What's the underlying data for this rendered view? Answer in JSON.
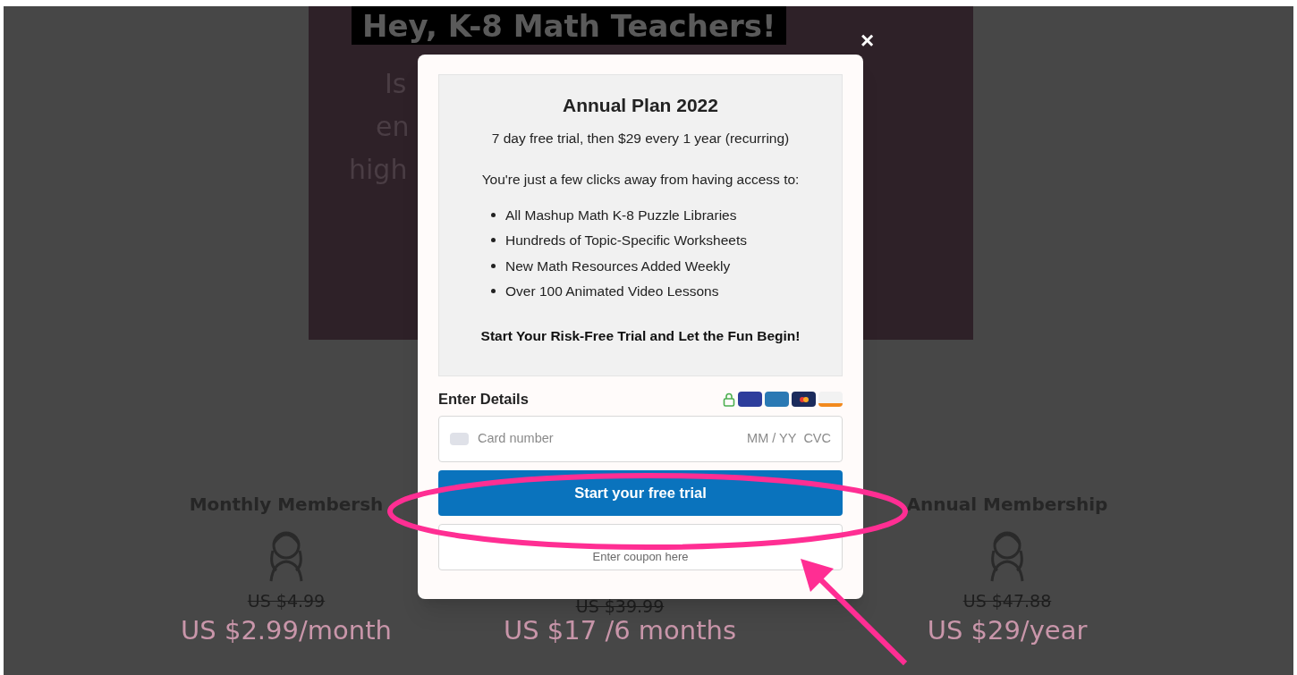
{
  "hero": {
    "title": "Hey, K-8 Math Teachers!",
    "fragments": [
      "Is",
      "en",
      "high"
    ]
  },
  "plans": [
    {
      "title": "Monthly Membersh",
      "old_price": "US $4.99",
      "price": "US $2.99/month"
    },
    {
      "old_price": "US $39.99",
      "price": "US $17 /6 months"
    },
    {
      "title": "Annual Membership",
      "old_price": "US $47.88",
      "price": "US $29/year"
    }
  ],
  "modal": {
    "close": "×",
    "plan_title": "Annual Plan 2022",
    "trial_text": "7 day free trial, then $29 every 1 year (recurring)",
    "intro": "You're just a few clicks away from having access to:",
    "features": [
      "All Mashup Math K-8 Puzzle Libraries",
      "Hundreds of Topic-Specific Worksheets",
      "New Math Resources Added Weekly",
      "Over 100 Animated Video Lessons"
    ],
    "closing": "Start Your Risk-Free Trial and Let the Fun Begin!",
    "details_label": "Enter Details",
    "card_field": {
      "placeholder": "Card number",
      "expiry": "MM / YY",
      "cvc": "CVC"
    },
    "button": "Start your free trial",
    "coupon": {
      "placeholder": "Enter coupon here"
    }
  },
  "annotations": {
    "highlight_ellipse": true,
    "pointer_arrow": true
  }
}
